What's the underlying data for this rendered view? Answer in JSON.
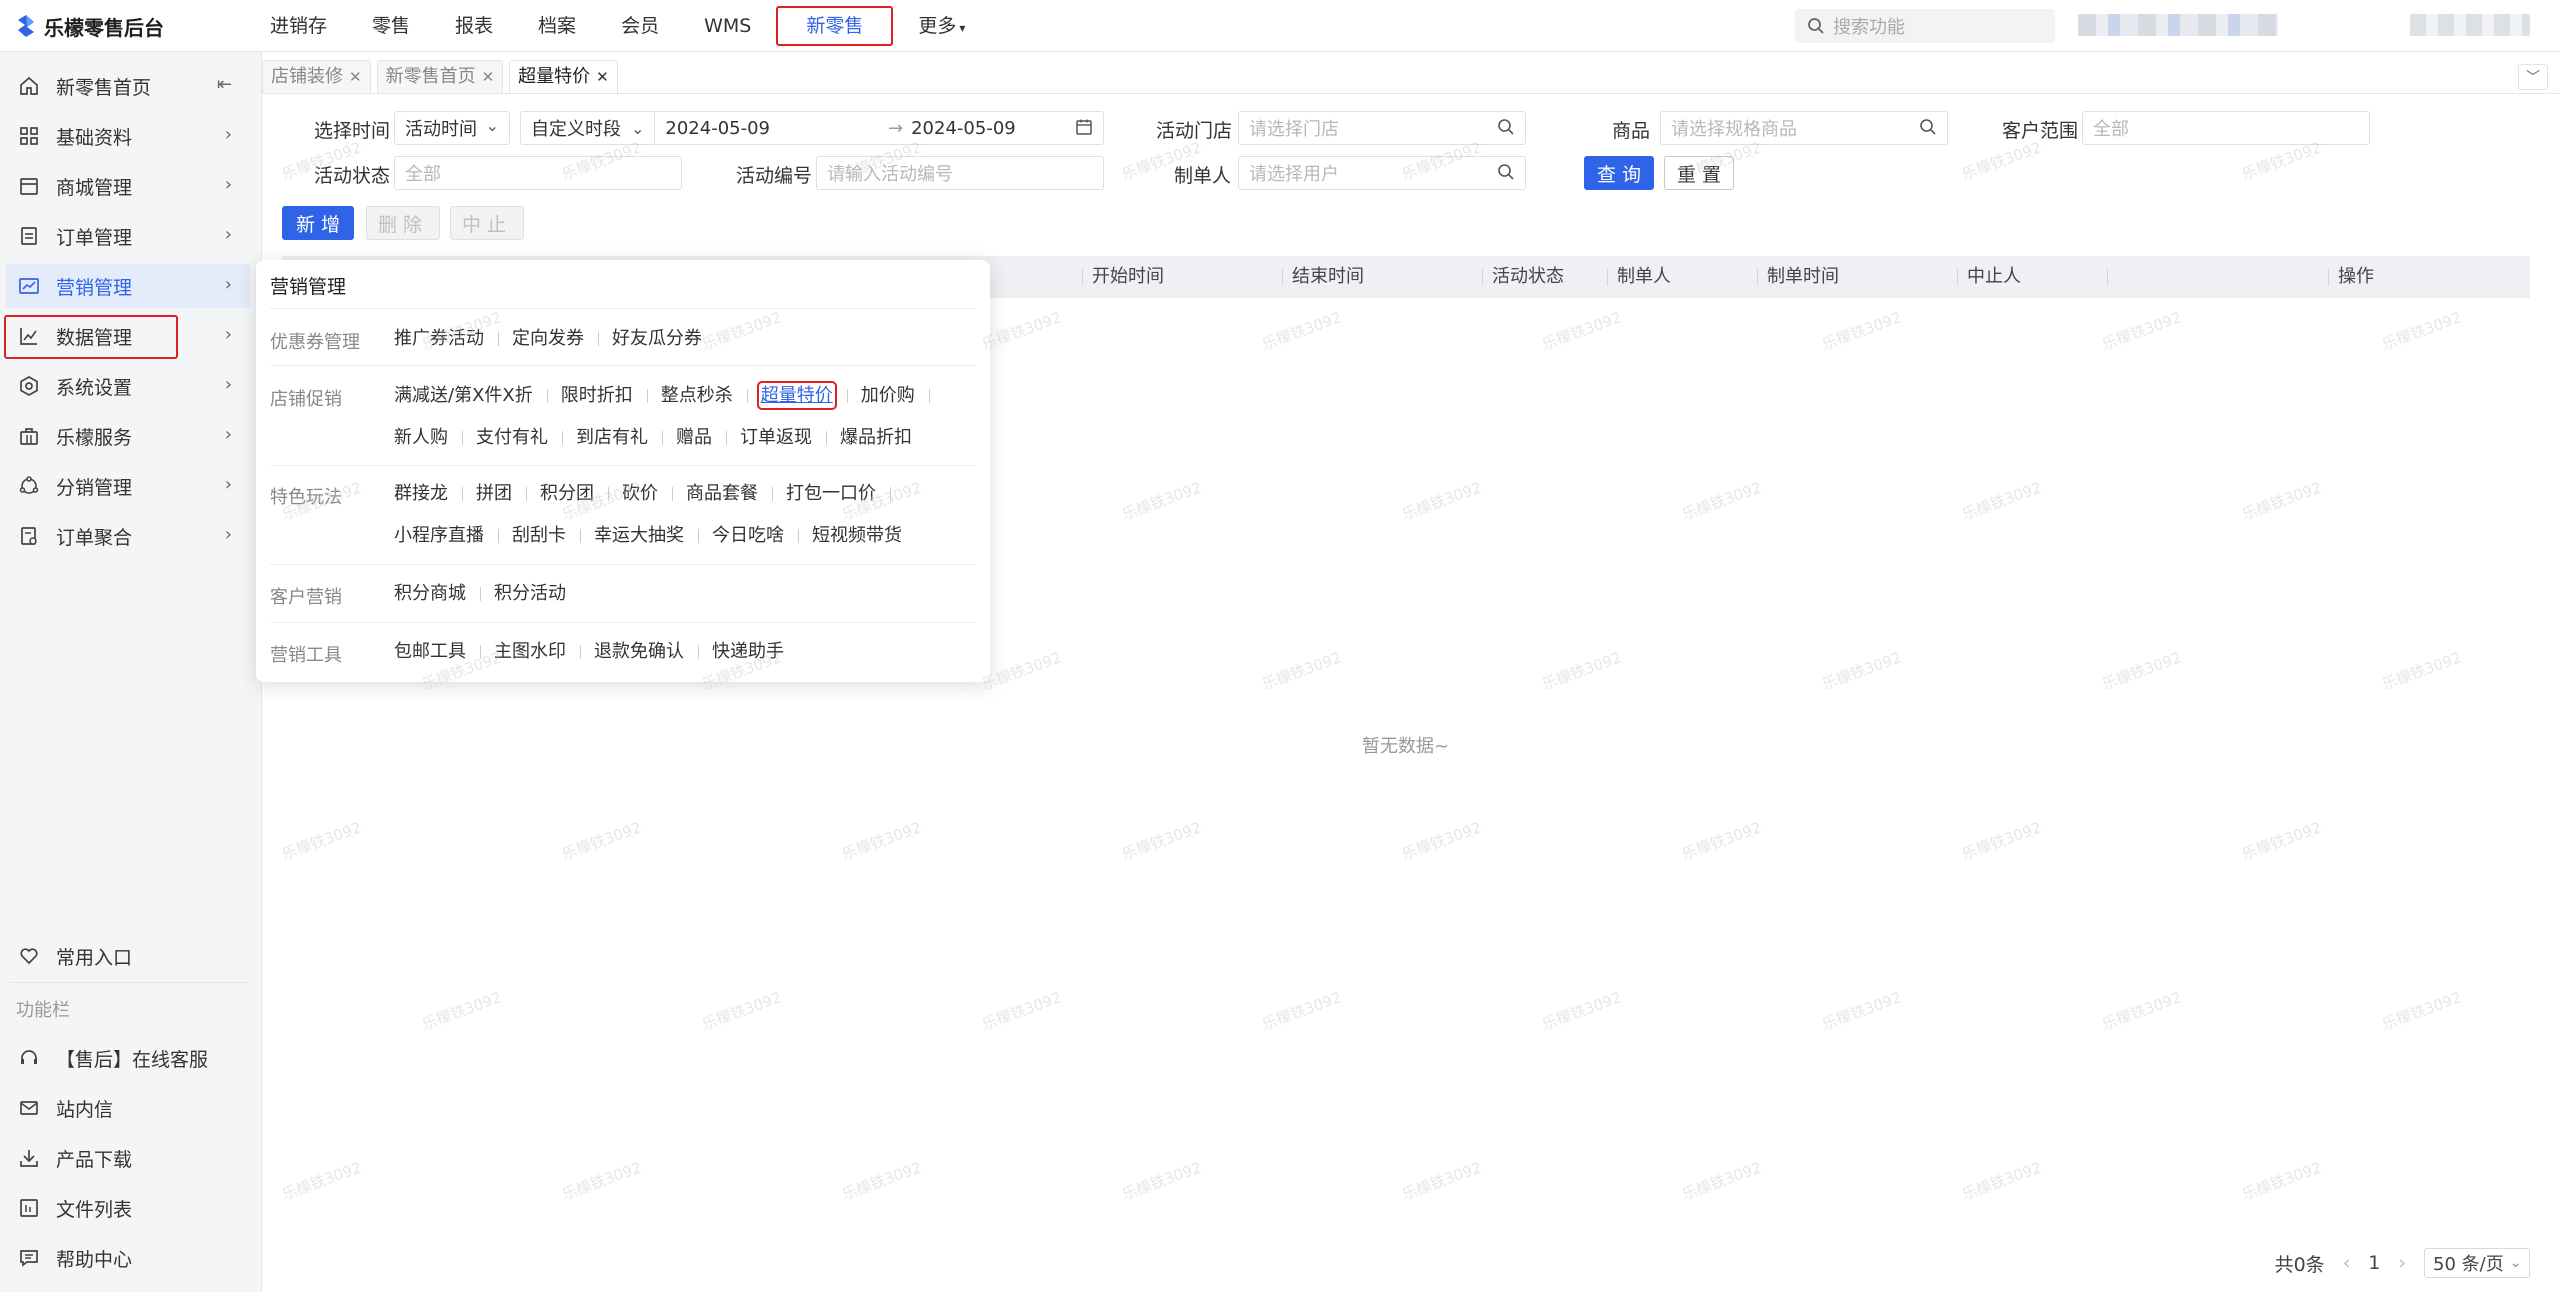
{
  "app": {
    "title": "乐檬零售后台"
  },
  "topnav": {
    "items": [
      "进销存",
      "零售",
      "报表",
      "档案",
      "会员",
      "WMS",
      "新零售",
      "更多"
    ],
    "active": "新零售",
    "search_placeholder": "搜索功能"
  },
  "sidebar": {
    "items": [
      {
        "label": "新零售首页",
        "icon": "home-icon"
      },
      {
        "label": "基础资料",
        "icon": "grid-icon"
      },
      {
        "label": "商城管理",
        "icon": "store-icon"
      },
      {
        "label": "订单管理",
        "icon": "document-icon"
      },
      {
        "label": "营销管理",
        "icon": "marketing-icon"
      },
      {
        "label": "数据管理",
        "icon": "chart-line-icon"
      },
      {
        "label": "系统设置",
        "icon": "settings-icon"
      },
      {
        "label": "乐檬服务",
        "icon": "briefcase-icon"
      },
      {
        "label": "分销管理",
        "icon": "network-icon"
      },
      {
        "label": "订单聚合",
        "icon": "order-aggregate-icon"
      }
    ],
    "favorites": "常用入口",
    "section_title": "功能栏",
    "tools": [
      {
        "label": "【售后】在线客服",
        "icon": "headset-icon"
      },
      {
        "label": "站内信",
        "icon": "mail-icon"
      },
      {
        "label": "产品下载",
        "icon": "download-icon"
      },
      {
        "label": "文件列表",
        "icon": "file-list-icon"
      },
      {
        "label": "帮助中心",
        "icon": "help-icon"
      }
    ]
  },
  "tabs": [
    {
      "label": "店铺装修"
    },
    {
      "label": "新零售首页"
    },
    {
      "label": "超量特价",
      "active": true
    }
  ],
  "filters": {
    "time_label": "选择时间",
    "time_type": "活动时间",
    "time_range_type": "自定义时段",
    "date_start": "2024-05-09",
    "date_end": "2024-05-09",
    "store_label": "活动门店",
    "store_placeholder": "请选择门店",
    "product_label": "商品",
    "product_placeholder": "请选择规格商品",
    "customer_label": "客户范围",
    "customer_value": "全部",
    "status_label": "活动状态",
    "status_value": "全部",
    "code_label": "活动编号",
    "code_placeholder": "请输入活动编号",
    "maker_label": "制单人",
    "maker_placeholder": "请选择用户",
    "query": "查 询",
    "reset": "重 置"
  },
  "actions": {
    "add": "新 增",
    "delete": "删除",
    "stop": "中止"
  },
  "table": {
    "columns": [
      "开始时间",
      "结束时间",
      "活动状态",
      "制单人",
      "制单时间",
      "中止人",
      "操作"
    ],
    "empty": "暂无数据~"
  },
  "pagination": {
    "total": "共0条",
    "page": "1",
    "page_size": "50 条/页"
  },
  "mega_menu": {
    "title": "营销管理",
    "groups": [
      {
        "name": "优惠券管理",
        "rows": [
          [
            "推广券活动",
            "定向发券",
            "好友瓜分券"
          ]
        ]
      },
      {
        "name": "店铺促销",
        "rows": [
          [
            "满减送/第X件X折",
            "限时折扣",
            "整点秒杀",
            "超量特价",
            "加价购"
          ],
          [
            "新人购",
            "支付有礼",
            "到店有礼",
            "赠品",
            "订单返现",
            "爆品折扣"
          ]
        ]
      },
      {
        "name": "特色玩法",
        "rows": [
          [
            "群接龙",
            "拼团",
            "积分团",
            "砍价",
            "商品套餐",
            "打包一口价"
          ],
          [
            "小程序直播",
            "刮刮卡",
            "幸运大抽奖",
            "今日吃啥",
            "短视频带货"
          ]
        ]
      },
      {
        "name": "客户营销",
        "rows": [
          [
            "积分商城",
            "积分活动"
          ]
        ]
      },
      {
        "name": "营销工具",
        "rows": [
          [
            "包邮工具",
            "主图水印",
            "退款免确认",
            "快递助手"
          ]
        ]
      }
    ],
    "highlighted": "超量特价"
  },
  "watermark": "乐檬铁3092",
  "colors": {
    "primary": "#2f64e8",
    "highlight_border": "#e02020"
  }
}
